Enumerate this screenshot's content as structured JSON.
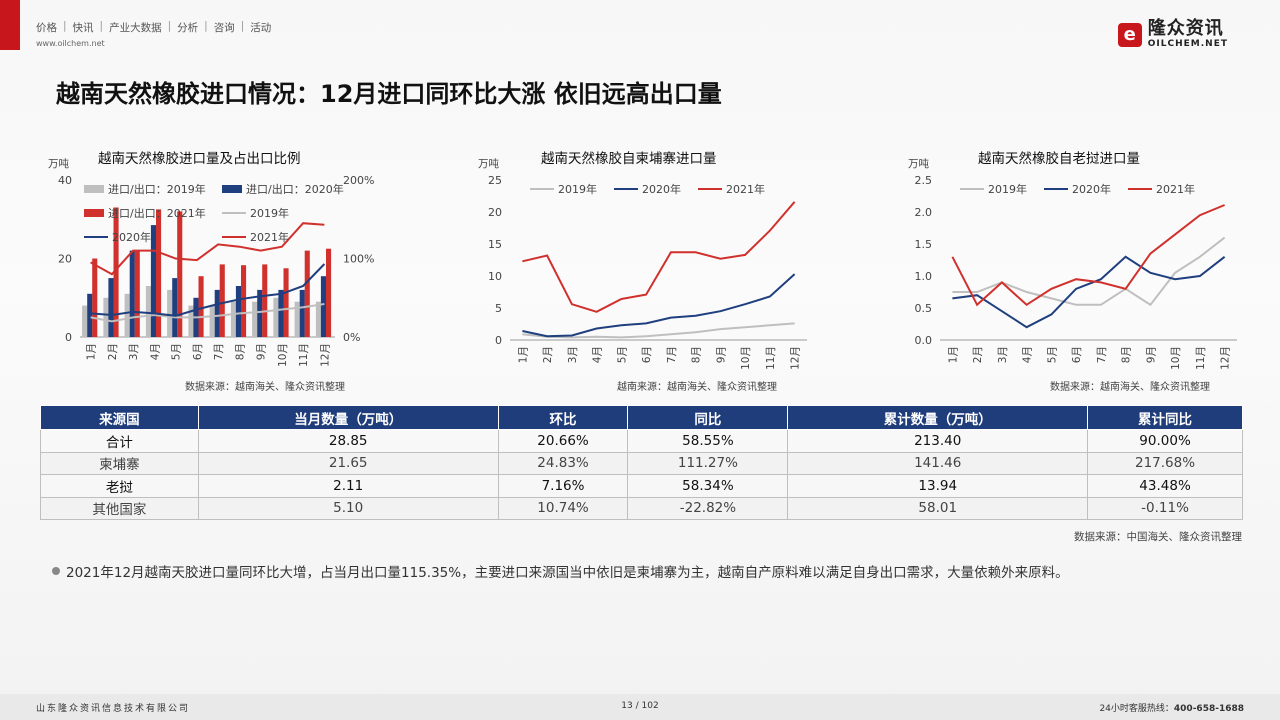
{
  "header": {
    "nav_items": [
      "价格",
      "快讯",
      "产业大数据",
      "分析",
      "咨询",
      "活动"
    ],
    "site_url": "www.oilchem.net",
    "logo_mark": "e",
    "logo_cn": "隆众资讯",
    "logo_en": "OILCHEM.NET"
  },
  "page_title": "越南天然橡胶进口情况：12月进口同环比大涨 依旧远高出口量",
  "colors": {
    "red": "#c8161d",
    "navy": "#1f3d7a",
    "grey": "#bfbfbf",
    "dark_blue": "#1f3f7f",
    "line_red": "#d0312d"
  },
  "chart_data": [
    {
      "type": "bar",
      "title": "越南天然橡胶进口量及占出口比例",
      "ylabel": "万吨",
      "ylim": [
        0,
        40
      ],
      "y_ticks": [
        "0",
        "20",
        "40"
      ],
      "y2lim": [
        0,
        200
      ],
      "y2_ticks": [
        "0%",
        "100%",
        "200%"
      ],
      "categories": [
        "1月",
        "2月",
        "3月",
        "4月",
        "5月",
        "6月",
        "7月",
        "8月",
        "9月",
        "10月",
        "11月",
        "12月"
      ],
      "series": [
        {
          "name": "进口/出口：2019年",
          "kind": "bar",
          "axis": "left",
          "color": "#bfbfbf",
          "values": [
            8,
            10,
            11,
            13,
            12,
            8,
            8,
            9,
            9,
            10,
            9,
            9
          ]
        },
        {
          "name": "进口/出口：2020年",
          "kind": "bar",
          "axis": "left",
          "color": "#1f3f7f",
          "values": [
            11,
            15,
            22,
            28.5,
            15,
            10,
            12,
            13,
            12,
            12,
            12,
            15.5
          ]
        },
        {
          "name": "进口/出口：2021年",
          "kind": "bar",
          "axis": "left",
          "color": "#d0312d",
          "values": [
            20,
            33,
            22,
            32.5,
            32,
            15.5,
            18.5,
            18.3,
            18.5,
            17.5,
            22,
            22.5
          ]
        },
        {
          "name": "2019年",
          "kind": "line",
          "axis": "right",
          "color": "#bfbfbf",
          "values": [
            25,
            20,
            25,
            28,
            25,
            25,
            27,
            30,
            32,
            35,
            38,
            42
          ]
        },
        {
          "name": "2020年",
          "kind": "line",
          "axis": "right",
          "color": "#1f3f7f",
          "values": [
            30,
            28,
            32,
            30,
            27,
            35,
            42,
            48,
            52,
            55,
            65,
            93
          ]
        },
        {
          "name": "2021年",
          "kind": "line",
          "axis": "right",
          "color": "#d0312d",
          "values": [
            95,
            80,
            110,
            110,
            100,
            98,
            118,
            115,
            110,
            115,
            145,
            143
          ]
        }
      ],
      "legend": "top",
      "source": "数据来源：越南海关、隆众资讯整理"
    },
    {
      "type": "line",
      "title": "越南天然橡胶自柬埔寨进口量",
      "ylabel": "万吨",
      "ylim": [
        0,
        25
      ],
      "y_ticks": [
        "0",
        "5",
        "10",
        "15",
        "20",
        "25"
      ],
      "categories": [
        "1月",
        "2月",
        "3月",
        "4月",
        "5月",
        "6月",
        "7月",
        "8月",
        "9月",
        "10月",
        "11月",
        "12月"
      ],
      "series": [
        {
          "name": "2019年",
          "color": "#bfbfbf",
          "values": [
            0.9,
            0.5,
            0.4,
            0.5,
            0.4,
            0.6,
            0.9,
            1.2,
            1.7,
            2.0,
            2.3,
            2.6
          ]
        },
        {
          "name": "2020年",
          "color": "#1f3f7f",
          "values": [
            1.4,
            0.6,
            0.7,
            1.8,
            2.3,
            2.6,
            3.5,
            3.8,
            4.5,
            5.6,
            6.8,
            10.3
          ]
        },
        {
          "name": "2021年",
          "color": "#d0312d",
          "values": [
            12.3,
            13.2,
            5.6,
            4.4,
            6.4,
            7.1,
            13.7,
            13.7,
            12.7,
            13.3,
            17.1,
            21.6
          ]
        }
      ],
      "legend": "top",
      "source": "越南来源：越南海关、隆众资讯整理"
    },
    {
      "type": "line",
      "title": "越南天然橡胶自老挝进口量",
      "ylabel": "万吨",
      "ylim": [
        0,
        2.5
      ],
      "y_ticks": [
        "0.0",
        "0.5",
        "1.0",
        "1.5",
        "2.0",
        "2.5"
      ],
      "categories": [
        "1月",
        "2月",
        "3月",
        "4月",
        "5月",
        "6月",
        "7月",
        "8月",
        "9月",
        "10月",
        "11月",
        "12月"
      ],
      "series": [
        {
          "name": "2019年",
          "color": "#bfbfbf",
          "values": [
            0.75,
            0.75,
            0.9,
            0.75,
            0.65,
            0.55,
            0.55,
            0.8,
            0.55,
            1.05,
            1.3,
            1.6
          ]
        },
        {
          "name": "2020年",
          "color": "#1f3f7f",
          "values": [
            0.65,
            0.7,
            0.45,
            0.2,
            0.4,
            0.8,
            0.95,
            1.3,
            1.05,
            0.95,
            1.0,
            1.3
          ]
        },
        {
          "name": "2021年",
          "color": "#d0312d",
          "values": [
            1.3,
            0.55,
            0.9,
            0.55,
            0.8,
            0.95,
            0.9,
            0.8,
            1.35,
            1.65,
            1.95,
            2.11
          ]
        }
      ],
      "legend": "top",
      "source": "数据来源：越南海关、隆众资讯整理"
    }
  ],
  "table": {
    "headers": [
      "来源国",
      "当月数量（万吨）",
      "环比",
      "同比",
      "累计数量（万吨）",
      "累计同比"
    ],
    "rows": [
      [
        "合计",
        "28.85",
        "20.66%",
        "58.55%",
        "213.40",
        "90.00%"
      ],
      [
        "柬埔寨",
        "21.65",
        "24.83%",
        "111.27%",
        "141.46",
        "217.68%"
      ],
      [
        "老挝",
        "2.11",
        "7.16%",
        "58.34%",
        "13.94",
        "43.48%"
      ],
      [
        "其他国家",
        "5.10",
        "10.74%",
        "-22.82%",
        "58.01",
        "-0.11%"
      ]
    ],
    "source": "数据来源：中国海关、隆众资讯整理"
  },
  "bullet_text": "2021年12月越南天胶进口量同环比大增，占当月出口量115.35%，主要进口来源国当中依旧是柬埔寨为主，越南自产原料难以满足自身出口需求，大量依赖外来原料。",
  "footer": {
    "company": "山东隆众资讯信息技术有限公司",
    "page": "13 / 102",
    "hotline_label": "24小时客服热线：",
    "hotline_number": "400-658-1688"
  }
}
